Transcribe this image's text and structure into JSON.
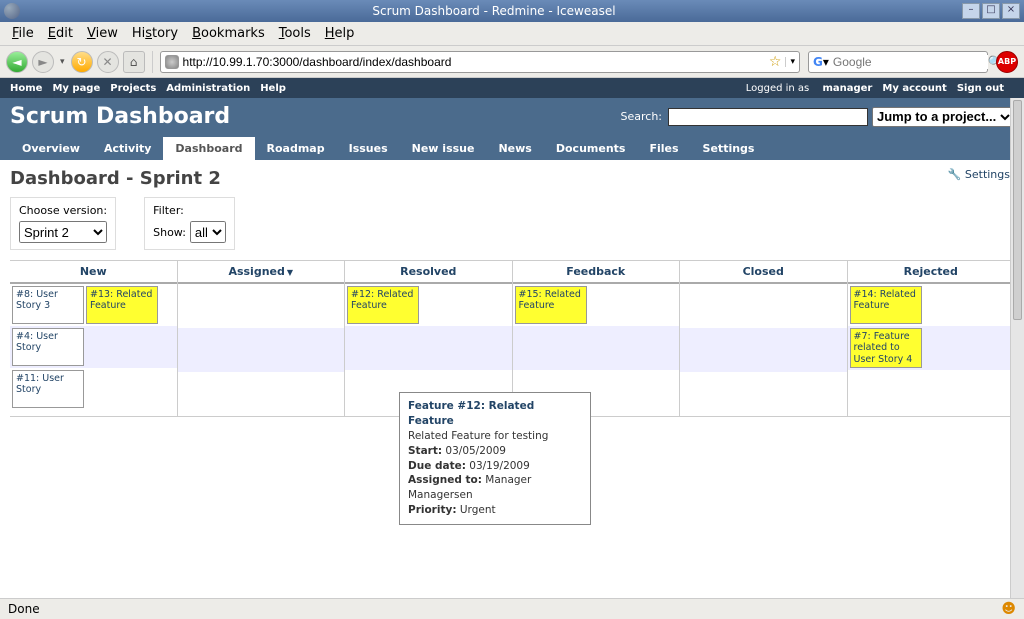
{
  "window": {
    "title": "Scrum Dashboard - Redmine - Iceweasel"
  },
  "browser": {
    "menus": [
      "File",
      "Edit",
      "View",
      "History",
      "Bookmarks",
      "Tools",
      "Help"
    ],
    "url": "http://10.99.1.70:3000/dashboard/index/dashboard",
    "search_placeholder": "Google",
    "abp": "ABP"
  },
  "redmine": {
    "topmenu_left": [
      "Home",
      "My page",
      "Projects",
      "Administration",
      "Help"
    ],
    "logged_in_prefix": "Logged in as ",
    "logged_in_user": "manager",
    "topmenu_right": [
      "My account",
      "Sign out"
    ],
    "project_title": "Scrum Dashboard",
    "search_label": "Search:",
    "jump_label": "Jump to a project...",
    "mainmenu": [
      "Overview",
      "Activity",
      "Dashboard",
      "Roadmap",
      "Issues",
      "New issue",
      "News",
      "Documents",
      "Files",
      "Settings"
    ],
    "mainmenu_selected": "Dashboard",
    "settings_link": "Settings"
  },
  "dashboard": {
    "heading": "Dashboard - Sprint 2",
    "choose_version_label": "Choose version:",
    "choose_version_value": "Sprint 2",
    "filter_label": "Filter:",
    "show_label": "Show:",
    "show_value": "all",
    "columns": [
      "New",
      "Assigned",
      "Resolved",
      "Feedback",
      "Closed",
      "Rejected"
    ],
    "sorted_col": "Assigned",
    "cards": {
      "new_r1_a": "#8: User Story 3",
      "new_r1_b": "#13: Related Feature",
      "new_r2_a": "#4: User Story",
      "new_r3_a": "#11: User Story",
      "resolved_r1_a": "#12: Related Feature",
      "feedback_r1_a": "#15: Related Feature",
      "rejected_r1_a": "#14: Related Feature",
      "rejected_r2_a": "#7: Feature related to User Story 4"
    },
    "tooltip": {
      "title": "Feature #12: Related Feature",
      "subtitle": "Related Feature for testing",
      "start_label": "Start:",
      "start_val": "03/05/2009",
      "due_label": "Due date:",
      "due_val": "03/19/2009",
      "assigned_label": "Assigned to:",
      "assigned_val": "Manager Managersen",
      "priority_label": "Priority:",
      "priority_val": "Urgent"
    }
  },
  "statusbar": {
    "text": "Done"
  }
}
